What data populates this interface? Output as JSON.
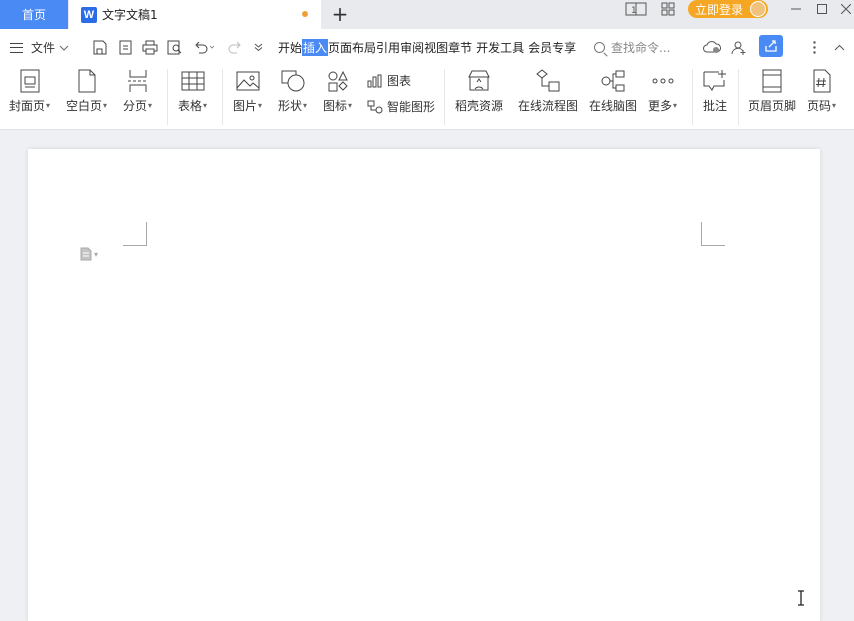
{
  "tabbar": {
    "home_label": "首页",
    "doc_icon_letter": "W",
    "doc_title": "文字文稿1",
    "new_tab_symbol": "+",
    "login_label": "立即登录"
  },
  "menubar": {
    "file_label": "文件",
    "tabs": [
      "开始",
      "插入",
      "页面布局",
      "引用",
      "审阅",
      "视图",
      "章节",
      "开发工具",
      "会员专享"
    ],
    "active_tab": "插入",
    "search_placeholder": "查找命令..."
  },
  "ribbon": {
    "cover_page": "封面页",
    "blank_page": "空白页",
    "page_break": "分页",
    "table": "表格",
    "picture": "图片",
    "shape": "形状",
    "icon": "图标",
    "chart": "图表",
    "smart_art": "智能图形",
    "docer_resources": "稻壳资源",
    "online_flowchart": "在线流程图",
    "online_mindmap": "在线脑图",
    "more": "更多",
    "comment": "批注",
    "header_footer": "页眉页脚",
    "page_number": "页码"
  },
  "colors": {
    "accent": "#4a8af4",
    "login": "#f5a623",
    "unsaved_dot": "#f29d38"
  }
}
